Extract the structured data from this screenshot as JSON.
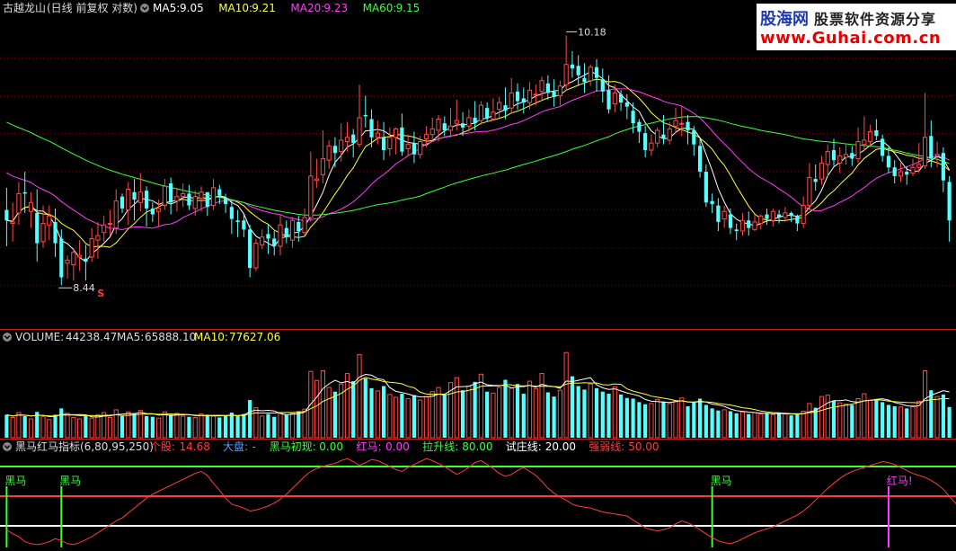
{
  "colors": {
    "background": "#000000",
    "up": "#ff4a4a",
    "down": "#54ffff",
    "ma5": "#ffffff",
    "ma10": "#ffff3c",
    "ma20": "#ff3cff",
    "ma60": "#3cff3c",
    "grid": "#7a0000",
    "divider": "#c81e1e"
  },
  "price_panel": {
    "stock_name": "古越龙山",
    "period_label": "(日线 前复权 对数)",
    "ma_labels": [
      {
        "name": "MA5:",
        "value": "9.05",
        "color": "#ffffff"
      },
      {
        "name": "MA10:",
        "value": "9.21",
        "color": "#ffff3c"
      },
      {
        "name": "MA20:",
        "value": "9.23",
        "color": "#ff3cff"
      },
      {
        "name": "MA60:",
        "value": "9.15",
        "color": "#3cff3c"
      }
    ],
    "high_label": "10.18",
    "low_label": "8.44",
    "s_marker": "S"
  },
  "volume_panel": {
    "title": "VOLUME:",
    "volume_value": "44238.47",
    "ma5_label": "MA5:",
    "ma5_value": "65888.10",
    "ma10_label": "MA10:",
    "ma10_value": "77627.06"
  },
  "indicator_panel": {
    "title": "黑马红马指标(6,80,95,250)",
    "items": [
      {
        "label": "个股:",
        "value": "14.68",
        "color": "#ff3c3c"
      },
      {
        "label": "大盘:",
        "value": "-",
        "color": "#4aa0ff"
      },
      {
        "label": "黑马初现:",
        "value": "0.00",
        "color": "#3cff3c"
      },
      {
        "label": "红马:",
        "value": "0.00",
        "color": "#ff3cff"
      },
      {
        "label": "拉升线:",
        "value": "80.00",
        "color": "#3cff3c"
      },
      {
        "label": "试庄线:",
        "value": "20.00",
        "color": "#ffffff"
      },
      {
        "label": "强弱线:",
        "value": "50.00",
        "color": "#ff3c3c"
      }
    ],
    "signals": [
      {
        "label": "黑马",
        "type": "black"
      },
      {
        "label": "黑马",
        "type": "black"
      },
      {
        "label": "黑马",
        "type": "black"
      },
      {
        "label": "红马!",
        "type": "red"
      }
    ]
  },
  "watermark": {
    "brand": "股海网",
    "subtitle": "股票软件资源分享",
    "url": "www.Guhai.com.cn"
  },
  "chart_data": {
    "type": "candlestick",
    "y_scale": "log",
    "ylim": [
      8.2,
      10.3
    ],
    "price_high": 10.18,
    "price_low": 8.44,
    "candles": [
      [
        8.93,
        8.86,
        9.08,
        8.69
      ],
      [
        8.84,
        8.85,
        8.98,
        8.72
      ],
      [
        8.91,
        9.04,
        9.12,
        8.83
      ],
      [
        9.05,
        9.04,
        9.19,
        8.91
      ],
      [
        8.92,
        8.98,
        9.05,
        8.81
      ],
      [
        8.91,
        8.71,
        9.07,
        8.59
      ],
      [
        8.72,
        8.84,
        8.96,
        8.68
      ],
      [
        8.83,
        8.89,
        8.96,
        8.73
      ],
      [
        8.85,
        8.71,
        8.94,
        8.62
      ],
      [
        8.74,
        8.49,
        8.8,
        8.44
      ],
      [
        8.58,
        8.6,
        8.63,
        8.48
      ],
      [
        8.57,
        8.65,
        8.68,
        8.47
      ],
      [
        8.62,
        8.63,
        8.73,
        8.53
      ],
      [
        8.61,
        8.59,
        8.7,
        8.47
      ],
      [
        8.62,
        8.74,
        8.81,
        8.59
      ],
      [
        8.73,
        8.76,
        8.85,
        8.61
      ],
      [
        8.78,
        8.83,
        8.89,
        8.72
      ],
      [
        8.84,
        8.84,
        8.93,
        8.76
      ],
      [
        8.81,
        8.99,
        9.07,
        8.77
      ],
      [
        9.02,
        8.94,
        9.04,
        8.91
      ],
      [
        8.93,
        9.07,
        9.12,
        8.83
      ],
      [
        9.05,
        9.0,
        9.14,
        8.86
      ],
      [
        8.98,
        9.05,
        9.18,
        8.92
      ],
      [
        9.06,
        8.94,
        9.09,
        8.82
      ],
      [
        8.94,
        8.9,
        8.98,
        8.85
      ],
      [
        8.92,
        8.94,
        9.0,
        8.82
      ],
      [
        8.96,
        9.09,
        9.14,
        8.93
      ],
      [
        9.11,
        8.98,
        9.15,
        8.9
      ],
      [
        8.99,
        9.02,
        9.08,
        8.92
      ],
      [
        9.02,
        9.04,
        9.11,
        8.95
      ],
      [
        9.04,
        8.96,
        9.1,
        8.93
      ],
      [
        8.94,
        9.02,
        9.06,
        8.89
      ],
      [
        9.01,
        9.05,
        9.09,
        8.92
      ],
      [
        9.05,
        8.95,
        9.05,
        8.89
      ],
      [
        8.96,
        9.08,
        9.14,
        8.93
      ],
      [
        9.07,
        9.03,
        9.1,
        8.97
      ],
      [
        9.01,
        8.97,
        9.04,
        8.91
      ],
      [
        8.95,
        8.87,
        9.0,
        8.77
      ],
      [
        8.86,
        8.85,
        8.93,
        8.75
      ],
      [
        8.86,
        8.8,
        8.91,
        8.75
      ],
      [
        8.8,
        8.55,
        8.83,
        8.49
      ],
      [
        8.55,
        8.71,
        8.74,
        8.53
      ],
      [
        8.7,
        8.75,
        8.8,
        8.67
      ],
      [
        8.77,
        8.74,
        8.83,
        8.64
      ],
      [
        8.74,
        8.69,
        8.79,
        8.63
      ],
      [
        8.69,
        8.83,
        8.9,
        8.63
      ],
      [
        8.81,
        8.75,
        8.86,
        8.71
      ],
      [
        8.73,
        8.86,
        8.88,
        8.68
      ],
      [
        8.85,
        8.79,
        8.89,
        8.72
      ],
      [
        8.78,
        8.88,
        8.94,
        8.76
      ],
      [
        8.88,
        9.16,
        9.33,
        8.85
      ],
      [
        9.13,
        9.14,
        9.28,
        9.08
      ],
      [
        9.17,
        9.28,
        9.48,
        9.11
      ],
      [
        9.27,
        9.37,
        9.41,
        9.21
      ],
      [
        9.37,
        9.32,
        9.43,
        9.22
      ],
      [
        9.33,
        9.41,
        9.53,
        9.26
      ],
      [
        9.4,
        9.43,
        9.54,
        9.33
      ],
      [
        9.45,
        9.39,
        9.49,
        9.29
      ],
      [
        9.38,
        9.57,
        9.81,
        9.36
      ],
      [
        9.59,
        9.58,
        9.73,
        9.5
      ],
      [
        9.56,
        9.43,
        9.63,
        9.36
      ],
      [
        9.43,
        9.46,
        9.55,
        9.38
      ],
      [
        9.43,
        9.34,
        9.54,
        9.27
      ],
      [
        9.35,
        9.43,
        9.5,
        9.3
      ],
      [
        9.43,
        9.49,
        9.5,
        9.31
      ],
      [
        9.5,
        9.33,
        9.6,
        9.3
      ],
      [
        9.35,
        9.38,
        9.45,
        9.3
      ],
      [
        9.39,
        9.31,
        9.47,
        9.25
      ],
      [
        9.31,
        9.4,
        9.44,
        9.28
      ],
      [
        9.42,
        9.45,
        9.51,
        9.36
      ],
      [
        9.45,
        9.49,
        9.57,
        9.4
      ],
      [
        9.48,
        9.56,
        9.59,
        9.4
      ],
      [
        9.53,
        9.48,
        9.58,
        9.44
      ],
      [
        9.48,
        9.51,
        9.64,
        9.43
      ],
      [
        9.53,
        9.55,
        9.7,
        9.48
      ],
      [
        9.53,
        9.5,
        9.61,
        9.44
      ],
      [
        9.51,
        9.57,
        9.63,
        9.47
      ],
      [
        9.57,
        9.53,
        9.69,
        9.48
      ],
      [
        9.55,
        9.66,
        9.69,
        9.52
      ],
      [
        9.64,
        9.57,
        9.68,
        9.54
      ],
      [
        9.56,
        9.61,
        9.71,
        9.55
      ],
      [
        9.63,
        9.68,
        9.72,
        9.57
      ],
      [
        9.66,
        9.62,
        9.79,
        9.56
      ],
      [
        9.64,
        9.75,
        9.86,
        9.6
      ],
      [
        9.76,
        9.69,
        9.82,
        9.63
      ],
      [
        9.71,
        9.68,
        9.79,
        9.6
      ],
      [
        9.68,
        9.77,
        9.83,
        9.63
      ],
      [
        9.74,
        9.74,
        9.81,
        9.66
      ],
      [
        9.76,
        9.84,
        9.87,
        9.7
      ],
      [
        9.82,
        9.75,
        9.88,
        9.7
      ],
      [
        9.76,
        9.72,
        9.85,
        9.65
      ],
      [
        9.73,
        9.8,
        9.84,
        9.66
      ],
      [
        9.81,
        9.96,
        10.18,
        9.77
      ],
      [
        9.96,
        9.93,
        10.06,
        9.86
      ],
      [
        9.95,
        9.88,
        10.03,
        9.8
      ],
      [
        9.86,
        9.83,
        9.97,
        9.75
      ],
      [
        9.84,
        9.94,
        9.96,
        9.8
      ],
      [
        9.94,
        9.86,
        10.0,
        9.76
      ],
      [
        9.85,
        9.76,
        9.93,
        9.68
      ],
      [
        9.77,
        9.63,
        9.88,
        9.6
      ],
      [
        9.67,
        9.75,
        9.81,
        9.61
      ],
      [
        9.74,
        9.68,
        9.77,
        9.62
      ],
      [
        9.68,
        9.65,
        9.74,
        9.56
      ],
      [
        9.62,
        9.53,
        9.68,
        9.46
      ],
      [
        9.54,
        9.47,
        9.56,
        9.39
      ],
      [
        9.46,
        9.34,
        9.51,
        9.29
      ],
      [
        9.34,
        9.39,
        9.45,
        9.3
      ],
      [
        9.39,
        9.48,
        9.5,
        9.36
      ],
      [
        9.45,
        9.42,
        9.59,
        9.38
      ],
      [
        9.41,
        9.49,
        9.54,
        9.38
      ],
      [
        9.51,
        9.55,
        9.64,
        9.46
      ],
      [
        9.53,
        9.53,
        9.65,
        9.44
      ],
      [
        9.54,
        9.48,
        9.59,
        9.38
      ],
      [
        9.48,
        9.38,
        9.51,
        9.3
      ],
      [
        9.37,
        9.19,
        9.42,
        9.15
      ],
      [
        9.19,
        8.98,
        9.24,
        8.95
      ],
      [
        8.99,
        8.97,
        9.04,
        8.91
      ],
      [
        8.96,
        8.85,
        9.01,
        8.79
      ],
      [
        8.87,
        8.92,
        8.96,
        8.81
      ],
      [
        8.9,
        8.81,
        8.94,
        8.77
      ],
      [
        8.8,
        8.79,
        8.84,
        8.73
      ],
      [
        8.79,
        8.86,
        8.91,
        8.76
      ],
      [
        8.86,
        8.81,
        8.92,
        8.76
      ],
      [
        8.8,
        8.85,
        8.9,
        8.79
      ],
      [
        8.84,
        8.89,
        8.9,
        8.8
      ],
      [
        8.9,
        8.87,
        8.94,
        8.83
      ],
      [
        8.86,
        8.92,
        8.94,
        8.82
      ],
      [
        8.9,
        8.88,
        8.93,
        8.84
      ],
      [
        8.88,
        8.91,
        8.95,
        8.85
      ],
      [
        8.91,
        8.89,
        8.92,
        8.85
      ],
      [
        8.89,
        8.84,
        8.9,
        8.79
      ],
      [
        8.84,
        8.96,
        9.02,
        8.81
      ],
      [
        8.96,
        9.15,
        9.25,
        8.93
      ],
      [
        9.14,
        9.12,
        9.24,
        9.06
      ],
      [
        9.14,
        9.25,
        9.3,
        9.1
      ],
      [
        9.24,
        9.33,
        9.38,
        9.16
      ],
      [
        9.34,
        9.27,
        9.42,
        9.23
      ],
      [
        9.25,
        9.3,
        9.36,
        9.18
      ],
      [
        9.29,
        9.31,
        9.38,
        9.24
      ],
      [
        9.32,
        9.28,
        9.37,
        9.23
      ],
      [
        9.28,
        9.4,
        9.5,
        9.25
      ],
      [
        9.38,
        9.41,
        9.58,
        9.33
      ],
      [
        9.4,
        9.47,
        9.52,
        9.36
      ],
      [
        9.48,
        9.44,
        9.56,
        9.41
      ],
      [
        9.42,
        9.3,
        9.45,
        9.26
      ],
      [
        9.3,
        9.22,
        9.36,
        9.18
      ],
      [
        9.22,
        9.16,
        9.27,
        9.11
      ],
      [
        9.16,
        9.19,
        9.25,
        9.12
      ],
      [
        9.19,
        9.17,
        9.23,
        9.1
      ],
      [
        9.18,
        9.22,
        9.28,
        9.16
      ],
      [
        9.22,
        9.24,
        9.39,
        9.18
      ],
      [
        9.23,
        9.43,
        9.75,
        9.21
      ],
      [
        9.44,
        9.28,
        9.55,
        9.22
      ],
      [
        9.3,
        9.31,
        9.4,
        9.22
      ],
      [
        9.32,
        9.13,
        9.36,
        9.05
      ],
      [
        9.12,
        8.86,
        9.16,
        8.72
      ]
    ],
    "ma_series": [
      {
        "name": "MA5",
        "color": "#ffffff",
        "window": 5
      },
      {
        "name": "MA10",
        "color": "#ffff3c",
        "window": 10
      },
      {
        "name": "MA20",
        "color": "#ff3cff",
        "window": 20
      },
      {
        "name": "MA60",
        "color": "#3cff3c",
        "window": 60
      }
    ],
    "volume": {
      "values": [
        33000,
        29000,
        36000,
        31000,
        27000,
        37000,
        30000,
        26000,
        33000,
        42000,
        35000,
        29000,
        27000,
        31000,
        28000,
        33000,
        36000,
        29000,
        40000,
        31000,
        37000,
        35000,
        39000,
        31000,
        30000,
        28000,
        37000,
        33000,
        35000,
        31000,
        30000,
        29000,
        34000,
        33000,
        31000,
        29000,
        32000,
        36000,
        31000,
        34000,
        54000,
        43000,
        31000,
        34000,
        30000,
        36000,
        33000,
        35000,
        38000,
        41000,
        95000,
        82000,
        96000,
        72000,
        66000,
        77000,
        92000,
        81000,
        119000,
        85000,
        71000,
        67000,
        74000,
        62000,
        58000,
        63000,
        56000,
        61000,
        54000,
        59000,
        66000,
        72000,
        61000,
        79000,
        86000,
        68000,
        74000,
        80000,
        91000,
        66000,
        64000,
        72000,
        83000,
        71000,
        77000,
        63000,
        81000,
        70000,
        92000,
        65000,
        59000,
        68000,
        122000,
        88000,
        74000,
        69000,
        77000,
        71000,
        66000,
        63000,
        73000,
        62000,
        57000,
        56000,
        51000,
        48000,
        49000,
        55000,
        52000,
        49000,
        53000,
        57000,
        45000,
        51000,
        56000,
        47000,
        42000,
        39000,
        40000,
        38000,
        35000,
        37000,
        34000,
        36000,
        34000,
        35000,
        33000,
        36000,
        34000,
        32000,
        33000,
        38000,
        49000,
        43000,
        59000,
        61000,
        53000,
        50000,
        48000,
        47000,
        56000,
        63000,
        54000,
        55000,
        51000,
        47000,
        45000,
        44000,
        42000,
        46000,
        52000,
        96000,
        68000,
        59000,
        62000,
        44000
      ],
      "ma_series": [
        {
          "name": "MA5",
          "color": "#ffffff",
          "window": 5
        },
        {
          "name": "MA10",
          "color": "#ffff3c",
          "window": 10
        }
      ],
      "ylim": [
        0,
        130000
      ]
    },
    "indicator": {
      "series_name": "个股",
      "color": "#ff3c3c",
      "ylim": [
        0,
        100
      ],
      "values": [
        16,
        12,
        9,
        4,
        2,
        1,
        2,
        4,
        7,
        5,
        2,
        1,
        3,
        6,
        9,
        13,
        17,
        21,
        25,
        28,
        33,
        38,
        43,
        48,
        52,
        55,
        58,
        61,
        64,
        67,
        70,
        73,
        75,
        71,
        63,
        56,
        48,
        42,
        40,
        38,
        35,
        36,
        38,
        40,
        43,
        47,
        52,
        58,
        64,
        70,
        75,
        78,
        80,
        82,
        83,
        86,
        88,
        85,
        81,
        84,
        87,
        86,
        83,
        80,
        77,
        75,
        79,
        82,
        85,
        88,
        86,
        83,
        80,
        76,
        72,
        75,
        79,
        84,
        86,
        82,
        78,
        73,
        70,
        72,
        76,
        79,
        75,
        71,
        65,
        58,
        53,
        49,
        46,
        42,
        40,
        39,
        38,
        36,
        34,
        33,
        32,
        31,
        30,
        26,
        22,
        18,
        16,
        15,
        16,
        18,
        22,
        25,
        23,
        20,
        16,
        12,
        8,
        5,
        3,
        2,
        4,
        7,
        10,
        13,
        15,
        17,
        19,
        22,
        25,
        28,
        31,
        35,
        40,
        46,
        52,
        58,
        63,
        68,
        72,
        75,
        77,
        79,
        81,
        83,
        85,
        84,
        82,
        79,
        76,
        73,
        71,
        69,
        66,
        62,
        57,
        50,
        43,
        35,
        25,
        14
      ],
      "lines": [
        {
          "name": "拉升线",
          "value": 80,
          "color": "#3cff3c"
        },
        {
          "name": "强弱线",
          "value": 50,
          "color": "#ff3c3c"
        },
        {
          "name": "试庄线",
          "value": 20,
          "color": "#ffffff"
        }
      ],
      "signal_index": [
        0,
        9,
        116,
        145
      ],
      "signal_types": [
        "black",
        "black",
        "black",
        "red"
      ]
    }
  }
}
